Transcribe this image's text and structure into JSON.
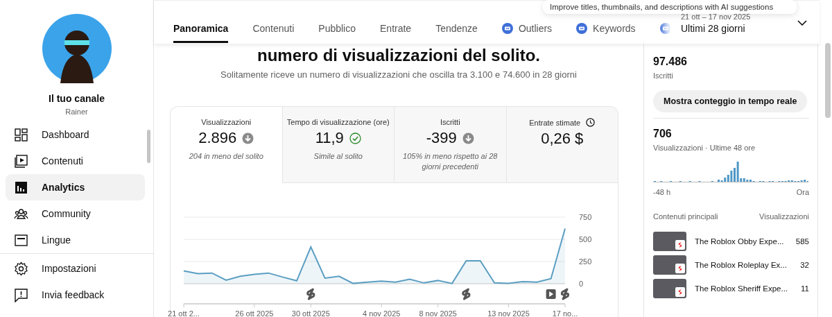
{
  "sidebar": {
    "channel_title": "Il tuo canale",
    "channel_name": "Rainer",
    "items": [
      {
        "label": "Dashboard",
        "selected": false
      },
      {
        "label": "Contenuti",
        "selected": false
      },
      {
        "label": "Analytics",
        "selected": true
      },
      {
        "label": "Community",
        "selected": false
      },
      {
        "label": "Lingue",
        "selected": false
      }
    ],
    "footer_items": [
      {
        "label": "Impostazioni"
      },
      {
        "label": "Invia feedback"
      }
    ]
  },
  "tabs": [
    {
      "label": "Panoramica",
      "selected": true,
      "ai": false
    },
    {
      "label": "Contenuti",
      "selected": false,
      "ai": false
    },
    {
      "label": "Pubblico",
      "selected": false,
      "ai": false
    },
    {
      "label": "Entrate",
      "selected": false,
      "ai": false
    },
    {
      "label": "Tendenze",
      "selected": false,
      "ai": false
    },
    {
      "label": "Outliers",
      "selected": false,
      "ai": true
    },
    {
      "label": "Keywords",
      "selected": false,
      "ai": true
    },
    {
      "selected": false,
      "ai": true
    }
  ],
  "ai_tooltip": "Improve titles, thumbnails, and descriptions with AI suggestions",
  "date_range": {
    "dates": "21 ott – 17 nov 2025",
    "label": "Ultimi 28 giorni"
  },
  "overview": {
    "headline": "numero di visualizzazioni del solito.",
    "subtitle": "Solitamente riceve un numero di visualizzazioni che oscilla tra 3.100 e 74.600 in 28 giorni",
    "metrics": [
      {
        "kind": "down",
        "label": "Visualizzazioni",
        "value": "2.896",
        "note": "204 in meno del solito",
        "selected": true
      },
      {
        "kind": "similar",
        "label": "Tempo di visualizzazione (ore)",
        "value": "11,9",
        "note": "Simile al solito",
        "selected": false
      },
      {
        "kind": "down",
        "label": "Iscritti",
        "value": "-399",
        "note": "105% in meno rispetto ai 28 giorni precedenti",
        "selected": false
      },
      {
        "kind": "pending",
        "label": "Entrate stimate",
        "value": "0,26 $",
        "selected": false
      }
    ],
    "upload_markers": [
      {
        "kind": "short"
      },
      {
        "kind": "short"
      },
      {
        "kind": "video"
      },
      {
        "kind": "short"
      }
    ],
    "chart_data": {
      "type": "area",
      "ylim": [
        0,
        750
      ],
      "yticks": [
        0,
        250,
        500,
        750
      ],
      "categories": [
        "21 ott 2...",
        null,
        null,
        null,
        null,
        "26 ott 2025",
        null,
        null,
        null,
        "30 ott 2025",
        null,
        null,
        null,
        null,
        "4 nov 2025",
        null,
        null,
        null,
        "8 nov 2025",
        null,
        null,
        null,
        null,
        "13 nov 2025",
        null,
        null,
        null,
        "17 no..."
      ],
      "series": [
        {
          "color": "#5a9ec2",
          "values": [
            144,
            114,
            120,
            39,
            84,
            105,
            120,
            75,
            33,
            414,
            63,
            84,
            3,
            18,
            30,
            18,
            51,
            9,
            36,
            3,
            258,
            258,
            9,
            3,
            24,
            18,
            57,
            621
          ]
        }
      ]
    }
  },
  "realtime": {
    "subscribers": "97.486",
    "subscribers_label": "Iscritti",
    "button": "Mostra conteggio in tempo reale",
    "views": "706",
    "views_label": "Visualizzazioni · Ultime 48 ore",
    "axis_start": "-48 h",
    "axis_end": "Ora",
    "top_heading": "Contenuti principali",
    "views_heading": "Visualizzazioni",
    "top_content": [
      {
        "title": "The Roblox Obby Expe...",
        "views": "585"
      },
      {
        "title": "The Roblox Roleplay Ex...",
        "views": "32"
      },
      {
        "title": "The Roblox Sheriff Expe...",
        "views": "11"
      }
    ]
  }
}
